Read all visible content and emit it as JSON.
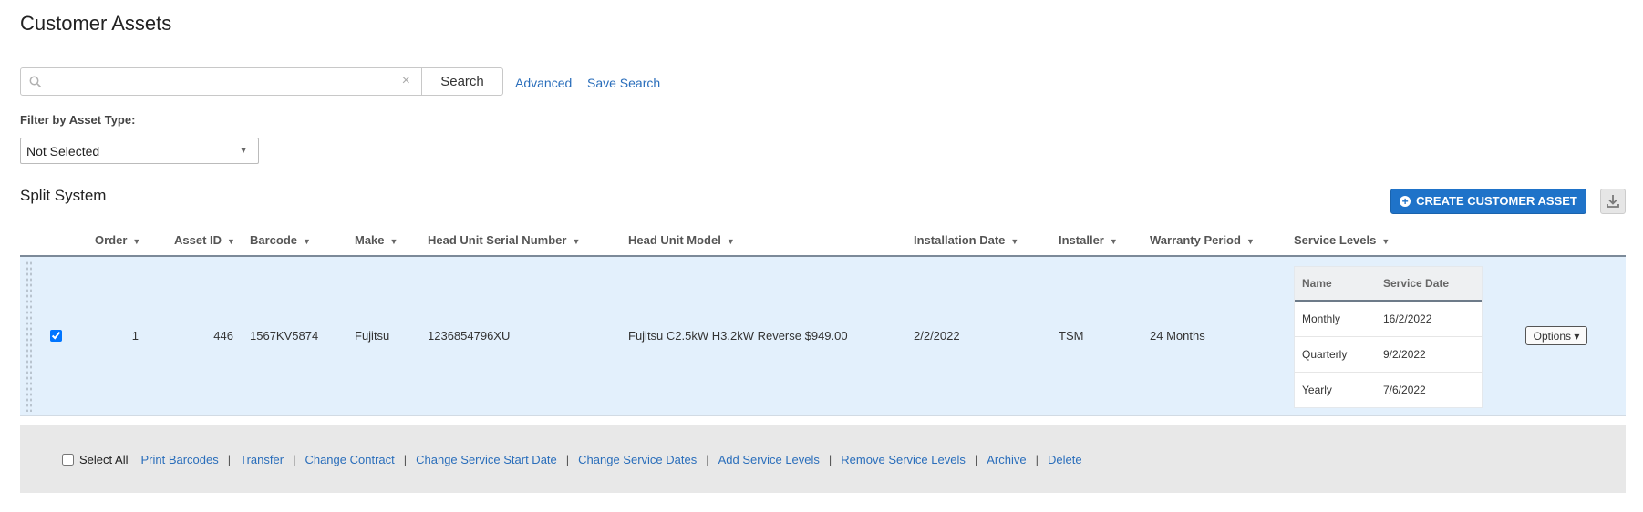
{
  "page": {
    "title": "Customer Assets"
  },
  "search": {
    "placeholder": "",
    "value": "",
    "button_label": "Search",
    "advanced_label": "Advanced",
    "save_label": "Save Search"
  },
  "filter": {
    "label": "Filter by Asset Type:",
    "selected": "Not Selected"
  },
  "section": {
    "title": "Split System",
    "create_label": "CREATE CUSTOMER ASSET"
  },
  "table": {
    "headers": {
      "order": "Order",
      "asset_id": "Asset ID",
      "barcode": "Barcode",
      "make": "Make",
      "serial": "Head Unit Serial Number",
      "model": "Head Unit Model",
      "install_date": "Installation Date",
      "installer": "Installer",
      "warranty": "Warranty Period",
      "service_levels": "Service Levels"
    },
    "rows": [
      {
        "checked": true,
        "order": "1",
        "asset_id": "446",
        "barcode": "1567KV5874",
        "make": "Fujitsu",
        "serial": "1236854796XU",
        "model": "Fujitsu C2.5kW H3.2kW Reverse $949.00",
        "install_date": "2/2/2022",
        "installer": "TSM",
        "warranty": "24 Months",
        "service_levels": {
          "headers": {
            "name": "Name",
            "date": "Service Date"
          },
          "items": [
            {
              "name": "Monthly",
              "date": "16/2/2022"
            },
            {
              "name": "Quarterly",
              "date": "9/2/2022"
            },
            {
              "name": "Yearly",
              "date": "7/6/2022"
            }
          ]
        },
        "options_label": "Options ▾"
      }
    ]
  },
  "footer": {
    "select_all": "Select All",
    "actions": [
      "Print Barcodes",
      "Transfer",
      "Change Contract",
      "Change Service Start Date",
      "Change Service Dates",
      "Add Service Levels",
      "Remove Service Levels",
      "Archive",
      "Delete"
    ]
  },
  "colors": {
    "link": "#2a6ebb",
    "primary_button": "#1f73c9",
    "row_highlight": "#e3f0fc"
  }
}
